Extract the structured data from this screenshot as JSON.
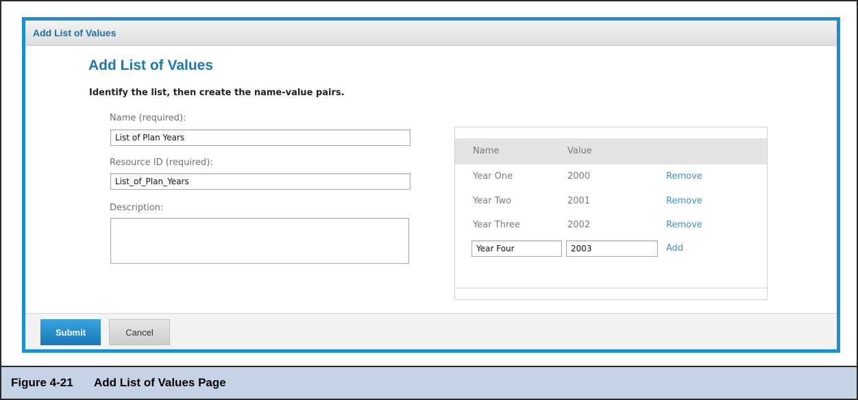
{
  "window": {
    "title": "Add List of Values"
  },
  "page": {
    "heading": "Add List of Values",
    "intro": "Identify the list, then create the name-value pairs."
  },
  "form": {
    "name_label": "Name (required):",
    "name_value": "List of Plan Years",
    "resource_id_label": "Resource ID (required):",
    "resource_id_value": "List_of_Plan_Years",
    "description_label": "Description:",
    "description_value": ""
  },
  "lov_table": {
    "columns": [
      "Name",
      "Value"
    ],
    "rows": [
      {
        "name": "Year One",
        "value": "2000",
        "action": "Remove"
      },
      {
        "name": "Year Two",
        "value": "2001",
        "action": "Remove"
      },
      {
        "name": "Year Three",
        "value": "2002",
        "action": "Remove"
      }
    ],
    "new_row": {
      "name": "Year Four",
      "value": "2003",
      "action": "Add"
    }
  },
  "footer": {
    "submit_label": "Submit",
    "cancel_label": "Cancel"
  },
  "caption": {
    "label": "Figure 4-21",
    "title": "Add List of Values Page"
  },
  "colors": {
    "accent": "#1a8fd1",
    "heading": "#1b78b4",
    "link": "#3a92c6",
    "caption_bg": "#c6d3e6"
  }
}
